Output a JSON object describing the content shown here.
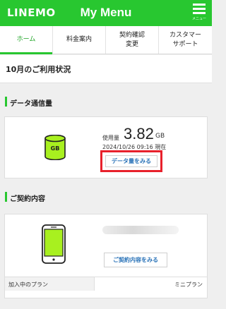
{
  "header": {
    "logo": "LINEMO",
    "title": "My Menu",
    "menu_label": "メニュー"
  },
  "tabs": [
    {
      "label": "ホーム",
      "active": true
    },
    {
      "label": "料金案内",
      "active": false
    },
    {
      "label": "契約確認\n変更",
      "active": false
    },
    {
      "label": "カスタマー\nサポート",
      "active": false
    }
  ],
  "usage_month": "10月のご利用状況",
  "data_section": {
    "heading": "データ通信量",
    "icon_text": "GB",
    "used_label": "使用量",
    "used_value": "3.82",
    "unit": "GB",
    "as_of": "2024/10/26 09:16 現在",
    "button_label": "データ量をみる"
  },
  "contract_section": {
    "heading": "ご契約内容",
    "button_label": "ご契約内容をみる",
    "plan_label": "加入中のプラン",
    "plan_value": "ミニプラン"
  },
  "colors": {
    "brand": "#28c730",
    "highlight": "#e8212c",
    "link": "#2a73b8",
    "icon_fill": "#a8f01f"
  }
}
